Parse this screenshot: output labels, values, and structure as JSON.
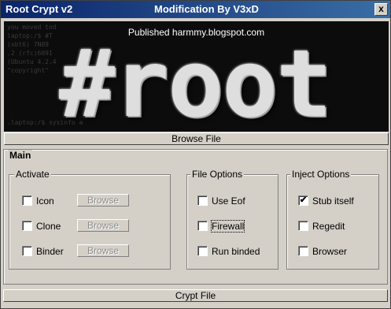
{
  "titlebar": {
    "app_title": "Root Crypt v2",
    "modification": "Modification By V3xD",
    "close_label": "x"
  },
  "banner": {
    "published_text": "Published harmmy.blogspot.com",
    "logo_text": "#root",
    "background_code": "you moved tod\nlaptop:/$ #T\n(xbt6) 7N09\n.2 (rfc)6091\n(Ubuntu 4.2.4\n\"copyright\"\n\n\n\n\n\n.laptop:/$ sysinfo a"
  },
  "buttons": {
    "browse_file": "Browse File",
    "crypt_file": "Crypt File"
  },
  "main": {
    "title": "Main",
    "activate": {
      "title": "Activate",
      "items": [
        {
          "label": "Icon",
          "checked": false,
          "browse_label": "Browse"
        },
        {
          "label": "Clone",
          "checked": false,
          "browse_label": "Browse"
        },
        {
          "label": "Binder",
          "checked": false,
          "browse_label": "Browse"
        }
      ]
    },
    "file_options": {
      "title": "File Options",
      "items": [
        {
          "label": "Use Eof",
          "checked": false
        },
        {
          "label": "Firewall",
          "checked": false
        },
        {
          "label": "Run binded",
          "checked": false
        }
      ]
    },
    "inject_options": {
      "title": "Inject Options",
      "items": [
        {
          "label": "Stub itself",
          "checked": true
        },
        {
          "label": "Regedit",
          "checked": false
        },
        {
          "label": "Browser",
          "checked": false
        }
      ]
    }
  },
  "check_mark": "✔"
}
